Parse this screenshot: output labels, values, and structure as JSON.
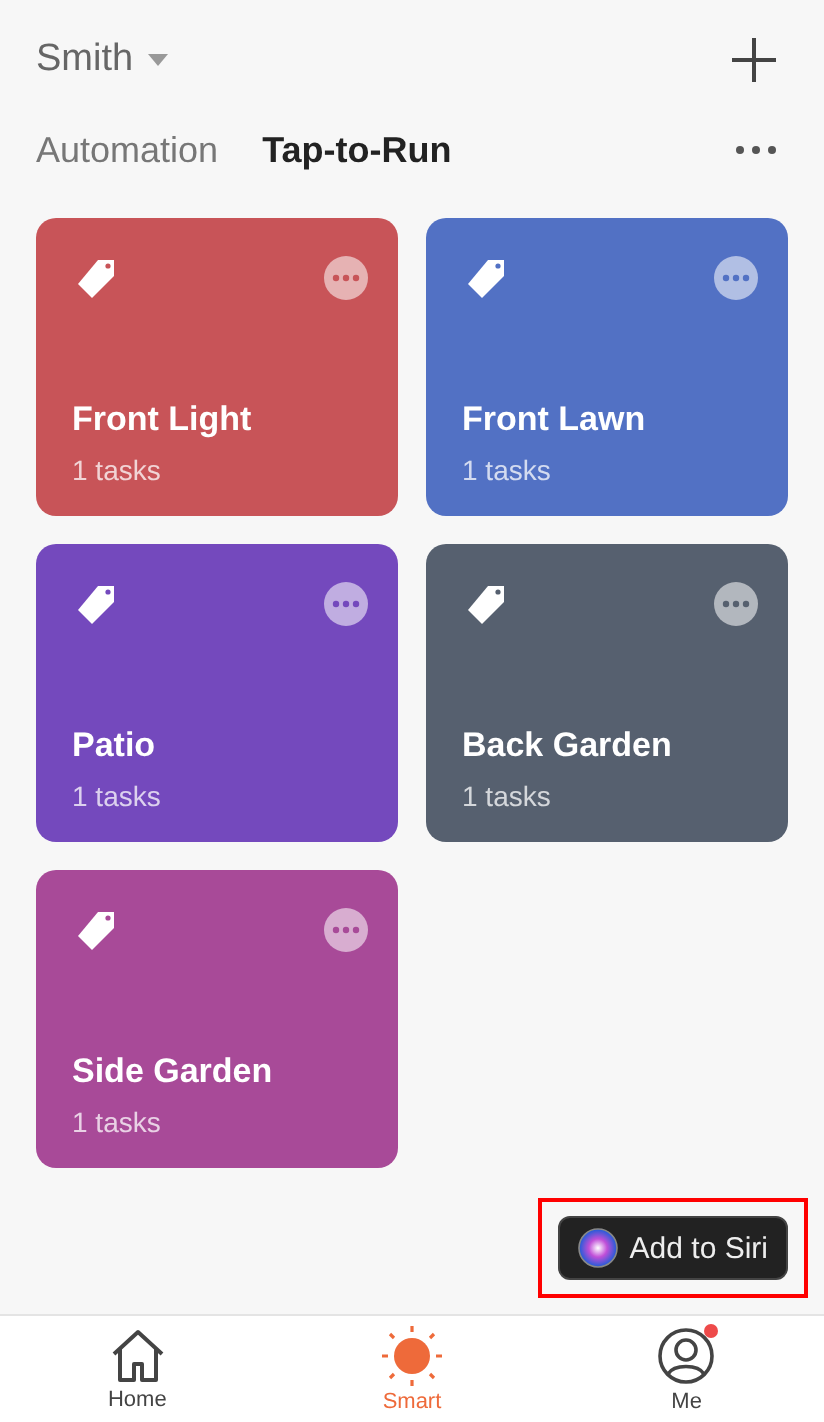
{
  "header": {
    "home_name": "Smith"
  },
  "tabs": [
    {
      "label": "Automation",
      "selected": false
    },
    {
      "label": "Tap-to-Run",
      "selected": true
    }
  ],
  "scenes": [
    {
      "name": "Front Light",
      "tasks": "1 tasks",
      "color": "#c85458"
    },
    {
      "name": "Front Lawn",
      "tasks": "1 tasks",
      "color": "#5271c4"
    },
    {
      "name": "Patio",
      "tasks": "1 tasks",
      "color": "#7449bd"
    },
    {
      "name": "Back Garden",
      "tasks": "1 tasks",
      "color": "#56606f"
    },
    {
      "name": "Side Garden",
      "tasks": "1 tasks",
      "color": "#a84a98"
    }
  ],
  "siri_button": {
    "label": "Add to Siri",
    "highlighted": true
  },
  "nav": [
    {
      "kind": "home",
      "label": "Home",
      "selected": false,
      "badge": false
    },
    {
      "kind": "smart",
      "label": "Smart",
      "selected": true,
      "badge": false
    },
    {
      "kind": "me",
      "label": "Me",
      "selected": false,
      "badge": true
    }
  ]
}
